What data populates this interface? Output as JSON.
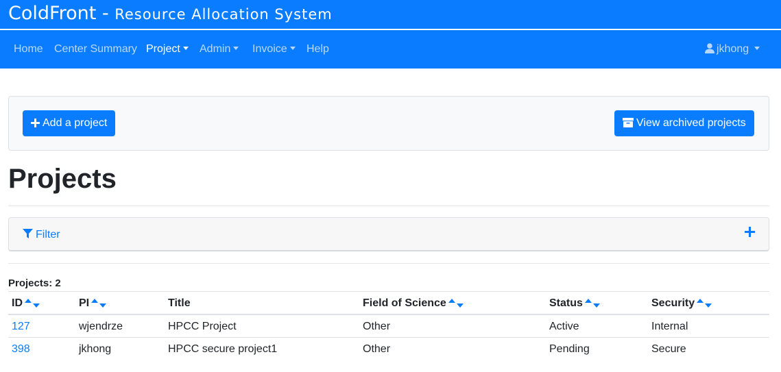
{
  "brand": {
    "name": "ColdFront",
    "separator": " - ",
    "subtitle": "Resource Allocation System"
  },
  "nav": {
    "home": "Home",
    "center_summary": "Center Summary",
    "project": "Project",
    "admin": "Admin",
    "invoice": "Invoice",
    "help": "Help",
    "user": "jkhong",
    "active_item": "Project"
  },
  "actions": {
    "add_project": "Add a project",
    "view_archived": "View archived projects"
  },
  "page": {
    "title": "Projects"
  },
  "filter": {
    "label": "Filter",
    "toggle_icon": "plus-icon"
  },
  "projects": {
    "count_label": "Projects: 2",
    "columns": [
      "ID",
      "PI",
      "Title",
      "Field of Science",
      "Status",
      "Security"
    ],
    "rows": [
      {
        "id": "127",
        "pi": "wjendrze",
        "title": "HPCC Project",
        "field": "Other",
        "status": "Active",
        "security": "Internal"
      },
      {
        "id": "398",
        "pi": "jkhong",
        "title": "HPCC secure project1",
        "field": "Other",
        "status": "Pending",
        "security": "Secure"
      }
    ]
  },
  "colors": {
    "primary": "#0a7cff",
    "nav_bg": "#0a7cff",
    "card_bg": "#f8f9fa",
    "text": "#212529"
  }
}
